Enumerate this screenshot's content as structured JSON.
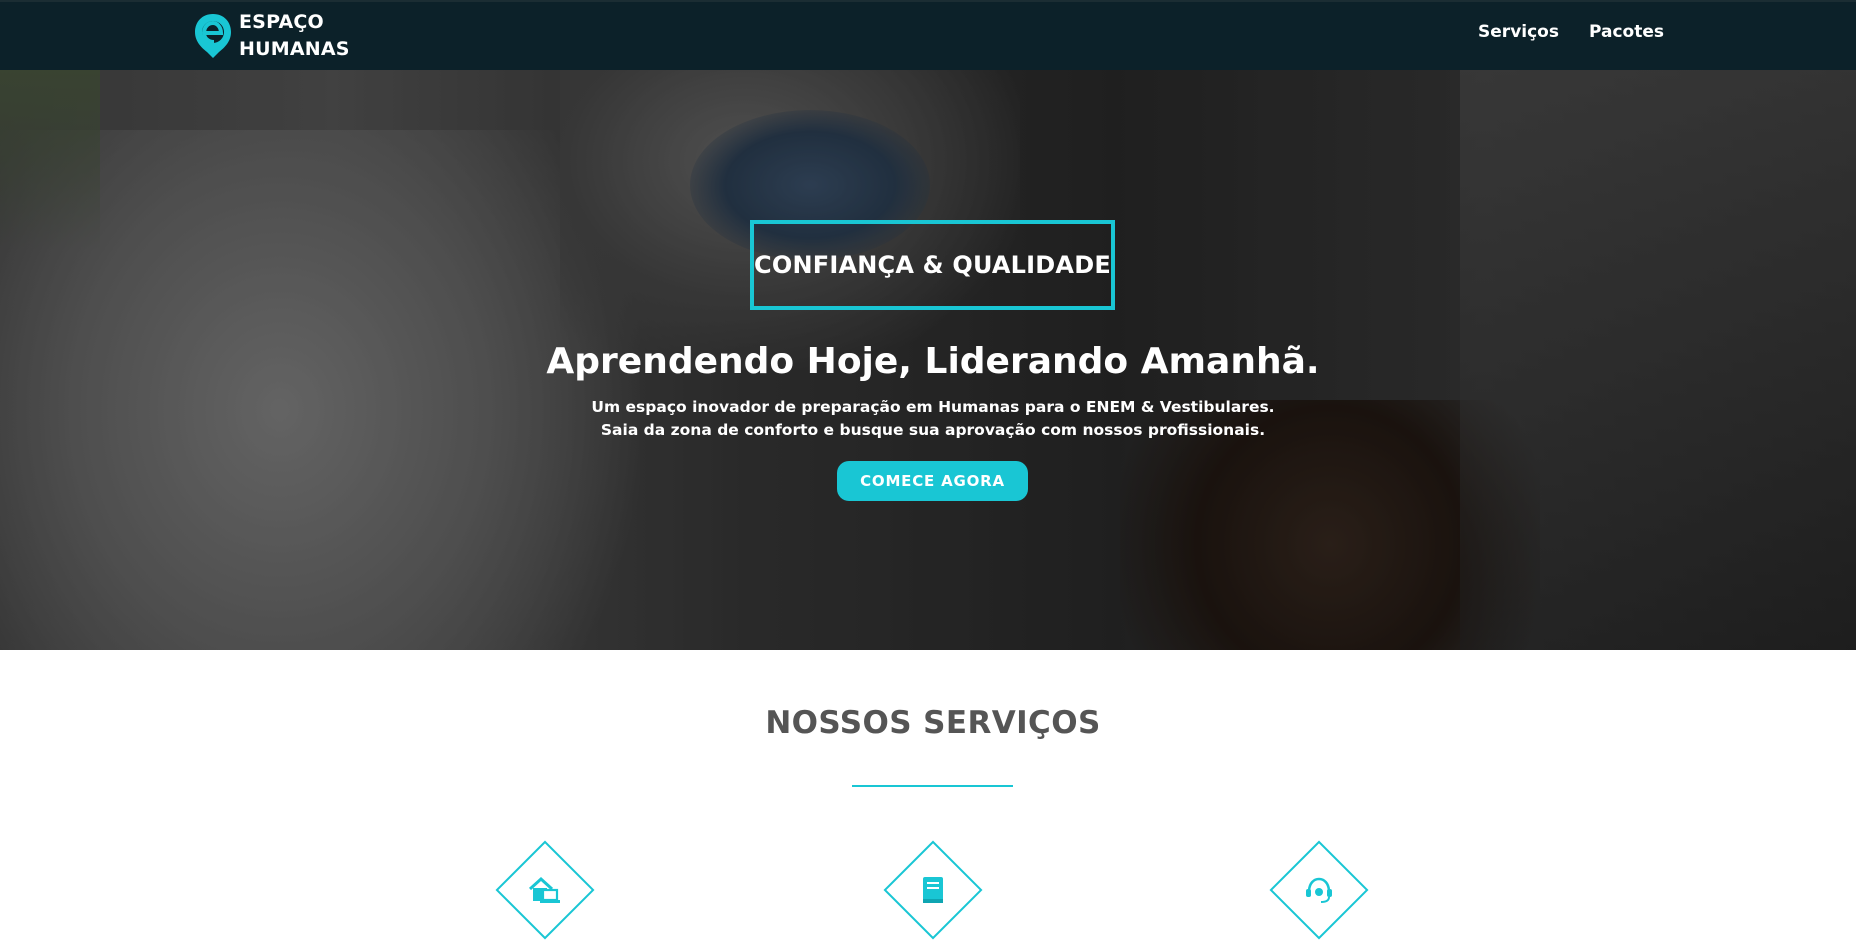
{
  "header": {
    "brand_line1": "ESPAÇO",
    "brand_line2": "HUMANAS",
    "nav": [
      {
        "label": "Serviços"
      },
      {
        "label": "Pacotes"
      }
    ]
  },
  "hero": {
    "badge": "CONFIANÇA & QUALIDADE",
    "title": "Aprendendo Hoje, Liderando Amanhã.",
    "subtitle_line1": "Um espaço inovador de preparação em Humanas para o ENEM & Vestibulares.",
    "subtitle_line2": "Saia da zona de conforto e busque sua aprovação com nossos profissionais.",
    "cta": "COMECE AGORA"
  },
  "services": {
    "title": "NOSSOS SERVIÇOS",
    "items": [
      {
        "icon": "home-laptop-icon"
      },
      {
        "icon": "book-icon"
      },
      {
        "icon": "headset-icon"
      }
    ]
  },
  "colors": {
    "accent": "#19c6d4",
    "topbar": "#0c2129",
    "heading": "#555555"
  }
}
